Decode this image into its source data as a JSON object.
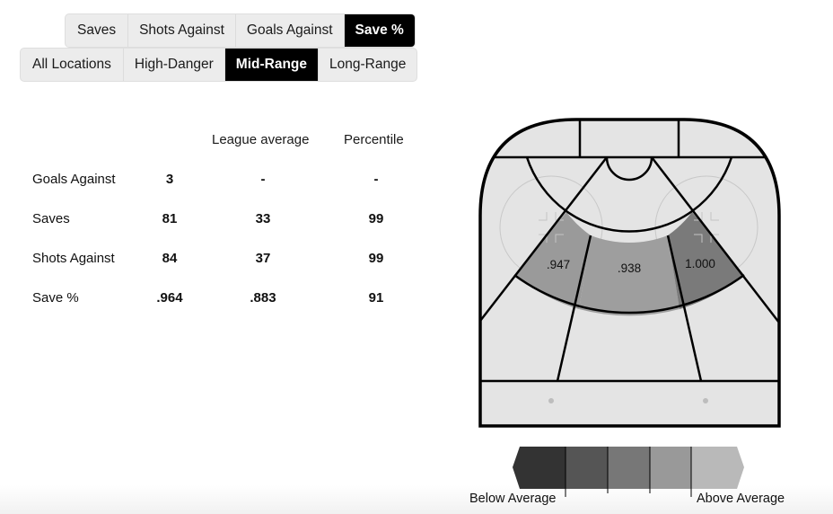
{
  "metric_tabs": [
    {
      "label": "Saves",
      "active": false
    },
    {
      "label": "Shots Against",
      "active": false
    },
    {
      "label": "Goals Against",
      "active": false
    },
    {
      "label": "Save %",
      "active": true
    }
  ],
  "location_tabs": [
    {
      "label": "All Locations",
      "active": false
    },
    {
      "label": "High-Danger",
      "active": false
    },
    {
      "label": "Mid-Range",
      "active": true
    },
    {
      "label": "Long-Range",
      "active": false
    }
  ],
  "stats_table": {
    "headers": [
      "",
      "",
      "League average",
      "Percentile"
    ],
    "rows": [
      {
        "label": "Goals Against",
        "value": "3",
        "league_average": "-",
        "percentile": "-"
      },
      {
        "label": "Saves",
        "value": "81",
        "league_average": "33",
        "percentile": "99"
      },
      {
        "label": "Shots Against",
        "value": "84",
        "league_average": "37",
        "percentile": "99"
      },
      {
        "label": "Save %",
        "value": ".964",
        "league_average": ".883",
        "percentile": "91"
      }
    ]
  },
  "rink": {
    "zones": [
      {
        "name": "mid-range-left",
        "label": ".947",
        "color": "#9a9a9a"
      },
      {
        "name": "mid-range-center",
        "label": ".938",
        "color": "#9e9e9e"
      },
      {
        "name": "mid-range-right",
        "label": "1.000",
        "color": "#7a7a7a"
      }
    ],
    "ice_color": "#e4e4e4"
  },
  "legend": {
    "below_label": "Below Average",
    "above_label": "Above Average",
    "colors": [
      "#333333",
      "#555555",
      "#777777",
      "#999999",
      "#b9b9b9"
    ]
  }
}
